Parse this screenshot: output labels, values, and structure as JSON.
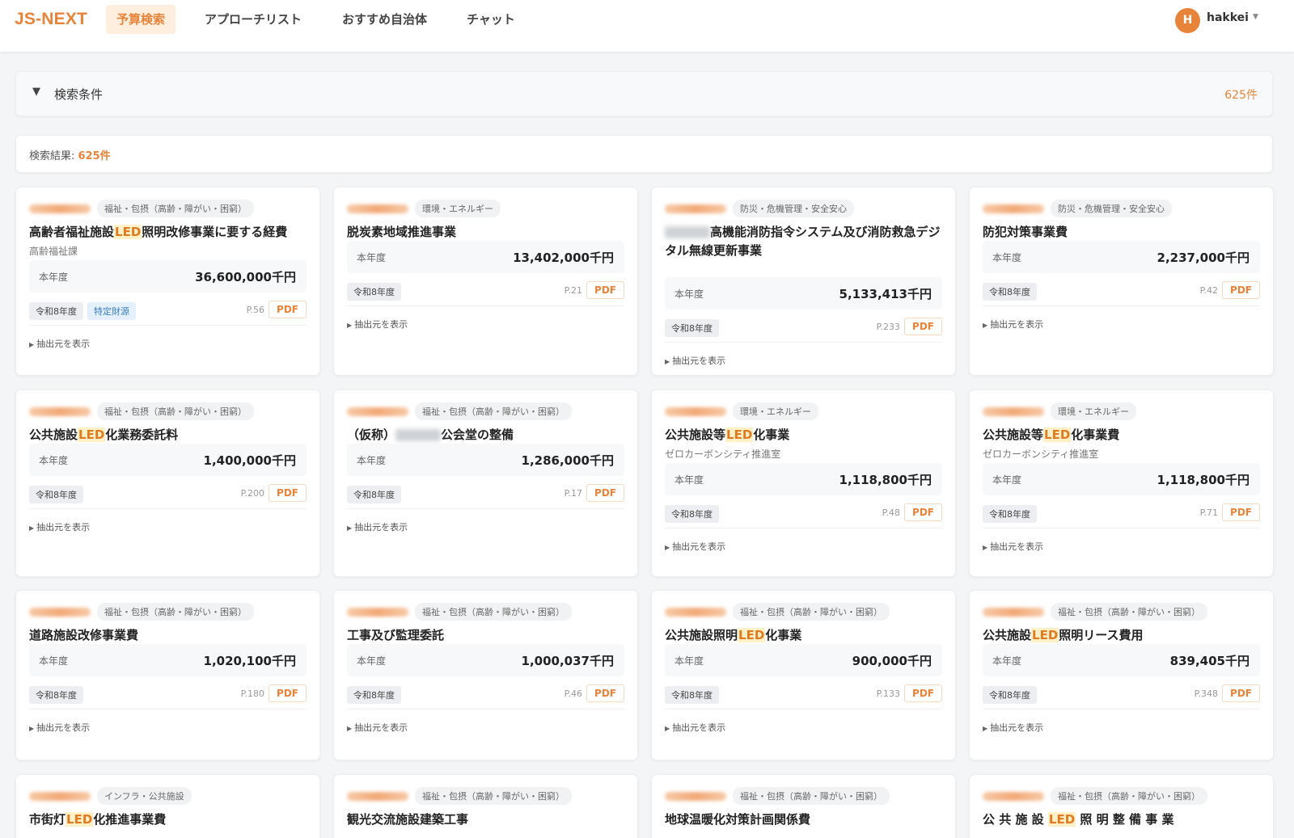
{
  "app": {
    "logo": "JS-NEXT",
    "nav": [
      "予算検索",
      "アプローチリスト",
      "おすすめ自治体",
      "チャット"
    ],
    "user": {
      "initial": "H",
      "name": "hakkei"
    }
  },
  "search": {
    "title": "検索条件",
    "count": "625件"
  },
  "results": {
    "label": "検索結果: ",
    "count": "625件"
  },
  "labels": {
    "amount": "本年度",
    "pdf": "PDF",
    "source": "抽出元を表示"
  },
  "cards": [
    {
      "category": "福祉・包摂（高齢・障がい・困窮）",
      "title_pre": "高齢者福祉施設",
      "title_hl": "LED",
      "title_post": "照明改修事業に要する経費",
      "dept": "高齢福祉課",
      "amount": "36,600,000千円",
      "year": "令和8年度",
      "fund": "特定財源",
      "page": "P.56"
    },
    {
      "category": "環境・エネルギー",
      "title_pre": "脱炭素地域推進事業",
      "title_hl": "",
      "title_post": "",
      "dept": "",
      "amount": "13,402,000千円",
      "year": "令和8年度",
      "fund": "",
      "page": "P.21"
    },
    {
      "category": "防災・危機管理・安全安心",
      "title_pre": "",
      "title_hl": "",
      "title_post": "高機能消防指令システム及び消防救急デジタル無線更新事業",
      "dept": "",
      "amount": "5,133,413千円",
      "year": "令和8年度",
      "fund": "",
      "page": "P.233"
    },
    {
      "category": "防災・危機管理・安全安心",
      "title_pre": "防犯対策事業費",
      "title_hl": "",
      "title_post": "",
      "dept": "",
      "amount": "2,237,000千円",
      "year": "令和8年度",
      "fund": "",
      "page": "P.42"
    },
    {
      "category": "福祉・包摂（高齢・障がい・困窮）",
      "title_pre": "公共施設",
      "title_hl": "LED",
      "title_post": "化業務委託料",
      "dept": "",
      "amount": "1,400,000千円",
      "year": "令和8年度",
      "fund": "",
      "page": "P.200"
    },
    {
      "category": "福祉・包摂（高齢・障がい・困窮）",
      "title_pre": "（仮称）",
      "title_hl": "",
      "title_post": "公会堂の整備",
      "dept": "",
      "amount": "1,286,000千円",
      "year": "令和8年度",
      "fund": "",
      "page": "P.17"
    },
    {
      "category": "環境・エネルギー",
      "title_pre": "公共施設等",
      "title_hl": "LED",
      "title_post": "化事業",
      "dept": "ゼロカーボンシティ推進室",
      "amount": "1,118,800千円",
      "year": "令和8年度",
      "fund": "",
      "page": "P.48"
    },
    {
      "category": "環境・エネルギー",
      "title_pre": "公共施設等",
      "title_hl": "LED",
      "title_post": "化事業費",
      "dept": "ゼロカーボンシティ推進室",
      "amount": "1,118,800千円",
      "year": "令和8年度",
      "fund": "",
      "page": "P.71"
    },
    {
      "category": "福祉・包摂（高齢・障がい・困窮）",
      "title_pre": "道路施設改修事業費",
      "title_hl": "",
      "title_post": "",
      "dept": "",
      "amount": "1,020,100千円",
      "year": "令和8年度",
      "fund": "",
      "page": "P.180"
    },
    {
      "category": "福祉・包摂（高齢・障がい・困窮）",
      "title_pre": "工事及び監理委託",
      "title_hl": "",
      "title_post": "",
      "dept": "",
      "amount": "1,000,037千円",
      "year": "令和8年度",
      "fund": "",
      "page": "P.46"
    },
    {
      "category": "福祉・包摂（高齢・障がい・困窮）",
      "title_pre": "公共施設照明",
      "title_hl": "LED",
      "title_post": "化事業",
      "dept": "",
      "amount": "900,000千円",
      "year": "令和8年度",
      "fund": "",
      "page": "P.133"
    },
    {
      "category": "福祉・包摂（高齢・障がい・困窮）",
      "title_pre": "公共施設",
      "title_hl": "LED",
      "title_post": "照明リース費用",
      "dept": "",
      "amount": "839,405千円",
      "year": "令和8年度",
      "fund": "",
      "page": "P.348"
    },
    {
      "category": "インフラ・公共施設",
      "title_pre": "市街灯",
      "title_hl": "LED",
      "title_post": "化推進事業費",
      "dept": "",
      "amount": "",
      "year": "",
      "fund": "",
      "page": ""
    },
    {
      "category": "福祉・包摂（高齢・障がい・困窮）",
      "title_pre": "観光交流施設建築工事",
      "title_hl": "",
      "title_post": "",
      "dept": "",
      "amount": "",
      "year": "",
      "fund": "",
      "page": ""
    },
    {
      "category": "福祉・包摂（高齢・障がい・困窮）",
      "title_pre": "地球温暖化対策計画関係費",
      "title_hl": "",
      "title_post": "",
      "dept": "",
      "amount": "",
      "year": "",
      "fund": "",
      "page": ""
    },
    {
      "category": "福祉・包摂（高齢・障がい・困窮）",
      "title_pre": "公 共 施 設 ",
      "title_hl": "LED",
      "title_post": " 照 明 整 備 事 業",
      "dept": "",
      "amount": "",
      "year": "",
      "fund": "",
      "page": ""
    }
  ],
  "colors": {
    "accent": "#e8833a",
    "highlight_bg": "#fff0c7",
    "fund_tag": "#3a7dc0"
  }
}
